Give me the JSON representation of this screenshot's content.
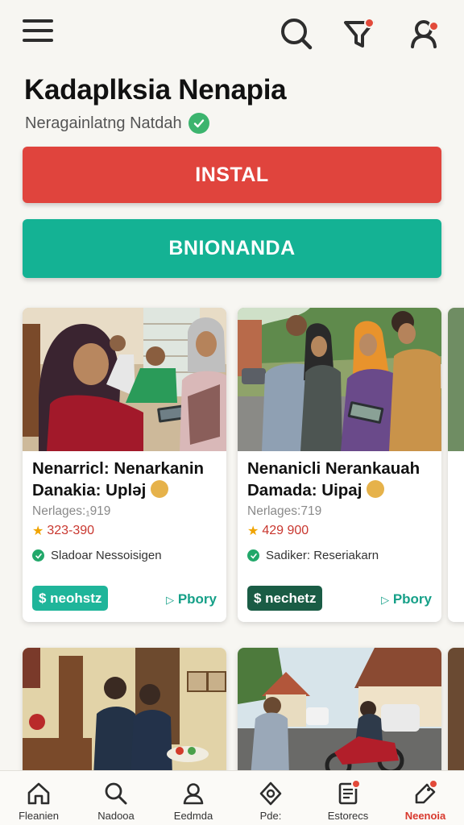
{
  "app": {
    "title": "Kadaplksia Nenapia",
    "subtitle": "Neragainlatng Natdah"
  },
  "buttons": {
    "primary": "INSTAL",
    "secondary": "BNIONANDA"
  },
  "cards": [
    {
      "title": "Nenarricl: Nenarkanin Danakia: Uplǝj",
      "meta": "Nerlages:₁919",
      "price": "323-390",
      "seller": "Sladoar Nessoisigen",
      "badge": "$ neohstz",
      "badge_color": "#1fb59a",
      "link": "Pbory"
    },
    {
      "title": "Nenanicli Nerankauah Damada: Uipaj",
      "meta": "Nerlages:719",
      "price": "429 900",
      "seller": "Sadiker: Reseriakarn",
      "badge": "$ nechetz",
      "badge_color": "#1a5c45",
      "link": "Pbory"
    }
  ],
  "nav": [
    {
      "label": "Fleanien",
      "icon": "home-icon"
    },
    {
      "label": "Nadooa",
      "icon": "search-icon"
    },
    {
      "label": "Eedmda",
      "icon": "profile-icon"
    },
    {
      "label": "Pde:",
      "icon": "ticket-icon"
    },
    {
      "label": "Estorecs",
      "icon": "notes-icon"
    },
    {
      "label": "Neenoia",
      "icon": "tag-icon",
      "active": true
    }
  ],
  "colors": {
    "install": "#e0443d",
    "secondary": "#14b294",
    "accent_red": "#e24a3a",
    "accent_green": "#16a088"
  }
}
